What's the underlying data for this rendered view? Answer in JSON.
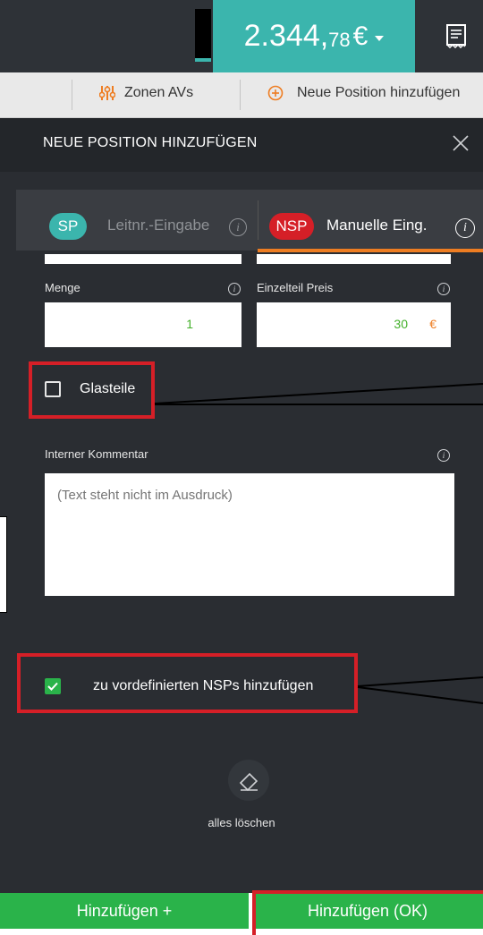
{
  "topbar": {
    "total_main": "2.344,",
    "total_cents": "78",
    "total_currency": "€"
  },
  "actionbar": {
    "zones_label": "Zonen AVs",
    "new_position_label": "Neue Position hinzufügen"
  },
  "panel": {
    "title": "NEUE POSITION HINZUFÜGEN",
    "tabs": [
      {
        "badge": "SP",
        "label": "Leitnr.-Eingabe",
        "active": false
      },
      {
        "badge": "NSP",
        "label": "Manuelle Eing.",
        "active": true
      }
    ],
    "quantity": {
      "label": "Menge",
      "value": "1"
    },
    "unit_price": {
      "label": "Einzelteil Preis",
      "value": "30",
      "currency": "€"
    },
    "glass_parts": {
      "label": "Glasteile",
      "checked": false
    },
    "internal_comment": {
      "label": "Interner Kommentar",
      "placeholder": "(Text steht nicht im Ausdruck)"
    },
    "add_to_predefined": {
      "label": "zu vordefinierten NSPs hinzufügen",
      "checked": true
    },
    "clear_all_label": "alles löschen"
  },
  "buttons": {
    "add_more": "Hinzufügen +",
    "add_ok": "Hinzufügen (OK)"
  },
  "colors": {
    "accent_teal": "#3bb5ad",
    "nsp_red": "#d51f27",
    "orange_underline": "#ee7d22",
    "green": "#2ab34a",
    "annotation_red": "#d51f27"
  }
}
